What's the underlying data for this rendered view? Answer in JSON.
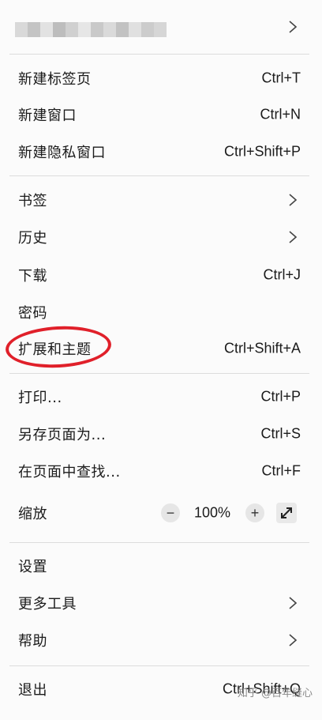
{
  "account": {
    "name_redacted": true,
    "blur_colors": [
      "#d9d9d9",
      "#c4c4c4",
      "#e2e2e2",
      "#bdbdbd",
      "#d0d0d0",
      "#e6e6e6",
      "#c9c9c9",
      "#dadada",
      "#c2c2c2",
      "#e0e0e0",
      "#cccccc",
      "#d6d6d6"
    ]
  },
  "menu": {
    "new_tab": {
      "label": "新建标签页",
      "shortcut": "Ctrl+T"
    },
    "new_window": {
      "label": "新建窗口",
      "shortcut": "Ctrl+N"
    },
    "new_private_window": {
      "label": "新建隐私窗口",
      "shortcut": "Ctrl+Shift+P"
    },
    "bookmarks": {
      "label": "书签"
    },
    "history": {
      "label": "历史"
    },
    "downloads": {
      "label": "下载",
      "shortcut": "Ctrl+J"
    },
    "passwords": {
      "label": "密码"
    },
    "extensions": {
      "label": "扩展和主题",
      "shortcut": "Ctrl+Shift+A"
    },
    "print": {
      "label": "打印...",
      "shortcut": "Ctrl+P"
    },
    "save_as": {
      "label": "另存页面为...",
      "shortcut": "Ctrl+S"
    },
    "find": {
      "label": "在页面中查找...",
      "shortcut": "Ctrl+F"
    },
    "zoom": {
      "label": "缩放",
      "minus": "−",
      "value": "100%",
      "plus": "+"
    },
    "settings": {
      "label": "设置"
    },
    "more_tools": {
      "label": "更多工具"
    },
    "help": {
      "label": "帮助"
    },
    "quit": {
      "label": "退出",
      "shortcut": "Ctrl+Shift+Q"
    }
  },
  "annotation": {
    "color": "#e0202a",
    "target": "extensions"
  },
  "watermark": "知乎 @百年缝心",
  "colors": {
    "text": "#1b1b1b",
    "separator": "#dcdcdc",
    "background": "#fbfbfb"
  }
}
